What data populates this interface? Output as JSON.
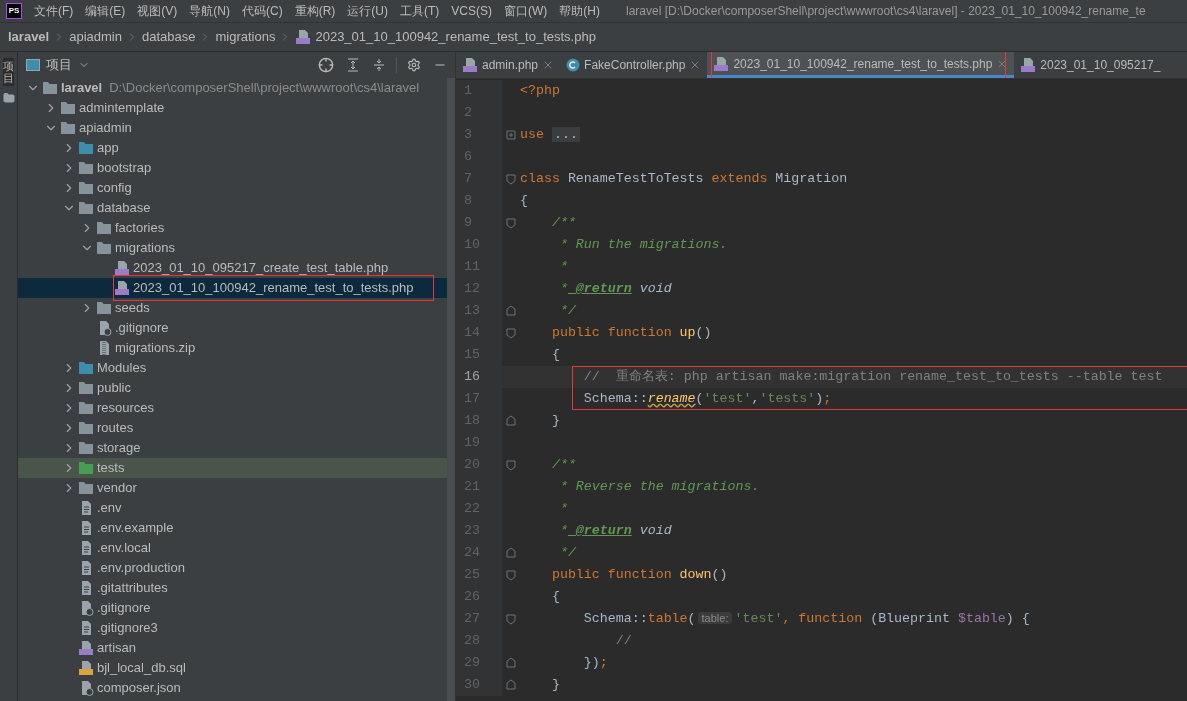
{
  "menu_bar": {
    "logo": "PS",
    "items": [
      "文件(F)",
      "编辑(E)",
      "视图(V)",
      "导航(N)",
      "代码(C)",
      "重构(R)",
      "运行(U)",
      "工具(T)",
      "VCS(S)",
      "窗口(W)",
      "帮助(H)"
    ],
    "title": "laravel [D:\\Docker\\composerShell\\project\\wwwroot\\cs4\\laravel] - 2023_01_10_100942_rename_te"
  },
  "breadcrumbs": [
    {
      "label": "laravel",
      "kind": "folder"
    },
    {
      "label": "apiadmin",
      "kind": "folder"
    },
    {
      "label": "database",
      "kind": "folder"
    },
    {
      "label": "migrations",
      "kind": "folder"
    },
    {
      "label": "2023_01_10_100942_rename_test_to_tests.php",
      "kind": "php"
    }
  ],
  "tool_strip": {
    "label": "项目"
  },
  "project_panel": {
    "title": "项目",
    "tree": [
      {
        "label": "laravel",
        "path": "D:\\Docker\\composerShell\\project\\wwwroot\\cs4\\laravel",
        "kind": "folder",
        "expanded": true,
        "selected": false,
        "annotated": false,
        "children": [
          {
            "label": "admintemplate",
            "kind": "folder",
            "expanded": false,
            "selected": false,
            "annotated": false
          },
          {
            "label": "apiadmin",
            "kind": "folder",
            "expanded": true,
            "selected": false,
            "annotated": false,
            "children": [
              {
                "label": "app",
                "kind": "source-folder",
                "expanded": false,
                "selected": false,
                "annotated": false
              },
              {
                "label": "bootstrap",
                "kind": "folder",
                "expanded": false,
                "selected": false,
                "annotated": false
              },
              {
                "label": "config",
                "kind": "folder",
                "expanded": false,
                "selected": false,
                "annotated": false
              },
              {
                "label": "database",
                "kind": "folder",
                "expanded": true,
                "selected": false,
                "annotated": false,
                "children": [
                  {
                    "label": "factories",
                    "kind": "folder",
                    "expanded": false,
                    "selected": false,
                    "annotated": false
                  },
                  {
                    "label": "migrations",
                    "kind": "folder",
                    "expanded": true,
                    "selected": false,
                    "annotated": false,
                    "children": [
                      {
                        "label": "2023_01_10_095217_create_test_table.php",
                        "kind": "php",
                        "selected": false,
                        "annotated": false
                      },
                      {
                        "label": "2023_01_10_100942_rename_test_to_tests.php",
                        "kind": "php",
                        "selected": true,
                        "annotated": true
                      }
                    ]
                  },
                  {
                    "label": "seeds",
                    "kind": "folder",
                    "expanded": false,
                    "selected": false,
                    "annotated": false
                  },
                  {
                    "label": ".gitignore",
                    "kind": "ignore",
                    "selected": false,
                    "annotated": false
                  },
                  {
                    "label": "migrations.zip",
                    "kind": "zip",
                    "selected": false,
                    "annotated": false
                  }
                ]
              },
              {
                "label": "Modules",
                "kind": "source-folder",
                "expanded": false,
                "selected": false,
                "annotated": false
              },
              {
                "label": "public",
                "kind": "folder",
                "expanded": false,
                "selected": false,
                "annotated": false
              },
              {
                "label": "resources",
                "kind": "folder",
                "expanded": false,
                "selected": false,
                "annotated": false
              },
              {
                "label": "routes",
                "kind": "folder",
                "expanded": false,
                "selected": false,
                "annotated": false
              },
              {
                "label": "storage",
                "kind": "folder",
                "expanded": false,
                "selected": false,
                "annotated": false
              },
              {
                "label": "tests",
                "kind": "test-folder",
                "expanded": false,
                "selected": false,
                "annotated": false
              },
              {
                "label": "vendor",
                "kind": "folder",
                "expanded": false,
                "selected": false,
                "annotated": false
              },
              {
                "label": ".env",
                "kind": "text",
                "selected": false,
                "annotated": false
              },
              {
                "label": ".env.example",
                "kind": "text",
                "selected": false,
                "annotated": false
              },
              {
                "label": ".env.local",
                "kind": "text",
                "selected": false,
                "annotated": false
              },
              {
                "label": ".env.production",
                "kind": "text",
                "selected": false,
                "annotated": false
              },
              {
                "label": ".gitattributes",
                "kind": "text",
                "selected": false,
                "annotated": false
              },
              {
                "label": ".gitignore",
                "kind": "ignore",
                "selected": false,
                "annotated": false
              },
              {
                "label": ".gitignore3",
                "kind": "text",
                "selected": false,
                "annotated": false
              },
              {
                "label": "artisan",
                "kind": "php",
                "selected": false,
                "annotated": false
              },
              {
                "label": "bjl_local_db.sql",
                "kind": "sql",
                "selected": false,
                "annotated": false
              },
              {
                "label": "composer.json",
                "kind": "json",
                "selected": false,
                "annotated": false
              }
            ]
          }
        ]
      }
    ]
  },
  "editor": {
    "tabs": [
      {
        "label": "admin.php",
        "kind": "php",
        "selected": false,
        "closable": true,
        "annotated": false
      },
      {
        "label": "FakeController.php",
        "kind": "class",
        "selected": false,
        "closable": true,
        "annotated": false
      },
      {
        "label": "2023_01_10_100942_rename_test_to_tests.php",
        "kind": "php",
        "selected": true,
        "closable": true,
        "annotated": true
      },
      {
        "label": "2023_01_10_095217_",
        "kind": "php",
        "selected": false,
        "closable": false,
        "annotated": false
      }
    ],
    "lines": [
      {
        "number": "1",
        "current": false,
        "annotated": false,
        "fold_start": false,
        "fold_end": false,
        "folded": false,
        "tokens": [
          {
            "kind": "keyword",
            "text": "<?php"
          }
        ]
      },
      {
        "number": "2",
        "current": false,
        "annotated": false,
        "fold_start": false,
        "fold_end": false,
        "folded": false
      },
      {
        "number": "3",
        "current": false,
        "annotated": false,
        "fold_start": false,
        "fold_end": false,
        "folded": true,
        "tokens": [
          {
            "kind": "keyword",
            "text": "use "
          },
          {
            "kind": "folded",
            "text": "..."
          }
        ]
      },
      {
        "number": "6",
        "current": false,
        "annotated": false,
        "fold_start": false,
        "fold_end": false,
        "folded": false
      },
      {
        "number": "7",
        "current": false,
        "annotated": false,
        "fold_start": true,
        "fold_end": false,
        "folded": false,
        "tokens": [
          {
            "kind": "keyword",
            "text": "class"
          },
          {
            "kind": "plain",
            "text": " RenameTestToTests "
          },
          {
            "kind": "keyword",
            "text": "extends"
          },
          {
            "kind": "plain",
            "text": " Migration"
          }
        ]
      },
      {
        "number": "8",
        "current": false,
        "annotated": false,
        "fold_start": false,
        "fold_end": false,
        "folded": false,
        "tokens": [
          {
            "kind": "plain",
            "text": "{"
          }
        ]
      },
      {
        "number": "9",
        "current": false,
        "annotated": false,
        "fold_start": true,
        "fold_end": false,
        "folded": false,
        "tokens": [
          {
            "kind": "doc",
            "text": "    /**"
          }
        ]
      },
      {
        "number": "10",
        "current": false,
        "annotated": false,
        "fold_start": false,
        "fold_end": false,
        "folded": false,
        "tokens": [
          {
            "kind": "doc",
            "text": "     * Run the migrations."
          }
        ]
      },
      {
        "number": "11",
        "current": false,
        "annotated": false,
        "fold_start": false,
        "fold_end": false,
        "folded": false,
        "tokens": [
          {
            "kind": "doc",
            "text": "     *"
          }
        ]
      },
      {
        "number": "12",
        "current": false,
        "annotated": false,
        "fold_start": false,
        "fold_end": false,
        "folded": false,
        "tokens": [
          {
            "kind": "doc",
            "text": "     *"
          },
          {
            "kind": "doctag",
            "text": " @return"
          },
          {
            "kind": "doctype",
            "text": " void"
          }
        ]
      },
      {
        "number": "13",
        "current": false,
        "annotated": false,
        "fold_start": false,
        "fold_end": true,
        "folded": false,
        "tokens": [
          {
            "kind": "doc",
            "text": "     */"
          }
        ]
      },
      {
        "number": "14",
        "current": false,
        "annotated": false,
        "fold_start": true,
        "fold_end": false,
        "folded": false,
        "tokens": [
          {
            "kind": "keyword",
            "text": "    public function"
          },
          {
            "kind": "function",
            "text": " up"
          },
          {
            "kind": "plain",
            "text": "()"
          }
        ]
      },
      {
        "number": "15",
        "current": false,
        "annotated": false,
        "fold_start": false,
        "fold_end": false,
        "folded": false,
        "tokens": [
          {
            "kind": "plain",
            "text": "    {"
          }
        ]
      },
      {
        "number": "16",
        "current": true,
        "annotated": true,
        "fold_start": false,
        "fold_end": false,
        "folded": false,
        "tokens": [
          {
            "kind": "comment",
            "text": "        //  重命名表: php artisan make:migration rename_test_to_tests --table test"
          }
        ]
      },
      {
        "number": "17",
        "current": false,
        "annotated": true,
        "fold_start": false,
        "fold_end": false,
        "folded": false,
        "tokens": [
          {
            "kind": "plain",
            "text": "        Schema::"
          },
          {
            "kind": "warning",
            "text": "rename"
          },
          {
            "kind": "plain",
            "text": "("
          },
          {
            "kind": "string",
            "text": "'test'"
          },
          {
            "kind": "plain",
            "text": ","
          },
          {
            "kind": "string",
            "text": "'tests'"
          },
          {
            "kind": "plain",
            "text": ")"
          },
          {
            "kind": "keyword",
            "text": ";"
          }
        ]
      },
      {
        "number": "18",
        "current": false,
        "annotated": false,
        "fold_start": false,
        "fold_end": true,
        "folded": false,
        "tokens": [
          {
            "kind": "plain",
            "text": "    }"
          }
        ]
      },
      {
        "number": "19",
        "current": false,
        "annotated": false,
        "fold_start": false,
        "fold_end": false,
        "folded": false
      },
      {
        "number": "20",
        "current": false,
        "annotated": false,
        "fold_start": true,
        "fold_end": false,
        "folded": false,
        "tokens": [
          {
            "kind": "doc",
            "text": "    /**"
          }
        ]
      },
      {
        "number": "21",
        "current": false,
        "annotated": false,
        "fold_start": false,
        "fold_end": false,
        "folded": false,
        "tokens": [
          {
            "kind": "doc",
            "text": "     * Reverse the migrations."
          }
        ]
      },
      {
        "number": "22",
        "current": false,
        "annotated": false,
        "fold_start": false,
        "fold_end": false,
        "folded": false,
        "tokens": [
          {
            "kind": "doc",
            "text": "     *"
          }
        ]
      },
      {
        "number": "23",
        "current": false,
        "annotated": false,
        "fold_start": false,
        "fold_end": false,
        "folded": false,
        "tokens": [
          {
            "kind": "doc",
            "text": "     *"
          },
          {
            "kind": "doctag",
            "text": " @return"
          },
          {
            "kind": "doctype",
            "text": " void"
          }
        ]
      },
      {
        "number": "24",
        "current": false,
        "annotated": false,
        "fold_start": false,
        "fold_end": true,
        "folded": false,
        "tokens": [
          {
            "kind": "doc",
            "text": "     */"
          }
        ]
      },
      {
        "number": "25",
        "current": false,
        "annotated": false,
        "fold_start": true,
        "fold_end": false,
        "folded": false,
        "tokens": [
          {
            "kind": "keyword",
            "text": "    public function"
          },
          {
            "kind": "function",
            "text": " down"
          },
          {
            "kind": "plain",
            "text": "()"
          }
        ]
      },
      {
        "number": "26",
        "current": false,
        "annotated": false,
        "fold_start": false,
        "fold_end": false,
        "folded": false,
        "tokens": [
          {
            "kind": "plain",
            "text": "    {"
          }
        ]
      },
      {
        "number": "27",
        "current": false,
        "annotated": false,
        "fold_start": true,
        "fold_end": false,
        "folded": false,
        "tokens": [
          {
            "kind": "plain",
            "text": "        Schema::"
          },
          {
            "kind": "keyword",
            "text": "table"
          },
          {
            "kind": "plain",
            "text": "("
          },
          {
            "kind": "hint",
            "text": "table:"
          },
          {
            "kind": "string",
            "text": "'test'"
          },
          {
            "kind": "keyword",
            "text": ", function"
          },
          {
            "kind": "plain",
            "text": " (Blueprint "
          },
          {
            "kind": "variable",
            "text": "$table"
          },
          {
            "kind": "plain",
            "text": ") {"
          }
        ]
      },
      {
        "number": "28",
        "current": false,
        "annotated": false,
        "fold_start": false,
        "fold_end": false,
        "folded": false,
        "tokens": [
          {
            "kind": "comment",
            "text": "            //"
          }
        ]
      },
      {
        "number": "29",
        "current": false,
        "annotated": false,
        "fold_start": false,
        "fold_end": true,
        "folded": false,
        "tokens": [
          {
            "kind": "plain",
            "text": "        })"
          },
          {
            "kind": "keyword",
            "text": ";"
          }
        ]
      },
      {
        "number": "30",
        "current": false,
        "annotated": false,
        "fold_start": false,
        "fold_end": true,
        "folded": false,
        "tokens": [
          {
            "kind": "plain",
            "text": "    }"
          }
        ]
      }
    ]
  }
}
